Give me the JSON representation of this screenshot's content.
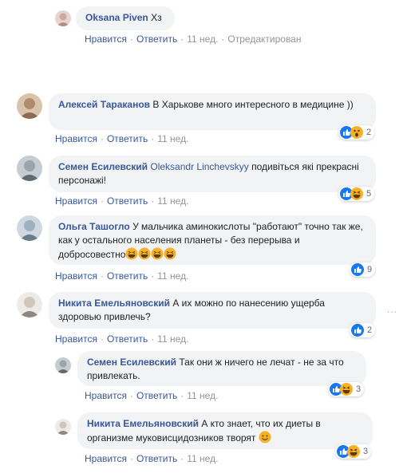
{
  "actions": {
    "like": "Нравится",
    "reply": "Ответить",
    "sep": "·"
  },
  "comments": [
    {
      "author": "Oksana Piven",
      "text": "Хз",
      "time": "11 нед.",
      "edited": "Отредактирован",
      "avatar_color": "#c9a8a0"
    },
    {
      "author": "Алексей Тараканов",
      "text": "В Харькове много интересного в медицине ))",
      "time": "11 нед.",
      "reactions": [
        "like",
        "wow"
      ],
      "reaction_count": "2",
      "avatar_color": "#b08b6e"
    },
    {
      "author": "Семен Есилевский",
      "mention": "Oleksandr Linchevskyy",
      "text": "подивіться які прекрасні персонажі!",
      "time": "11 нед.",
      "reactions": [
        "like",
        "haha"
      ],
      "reaction_count": "5",
      "avatar_color": "#7f8a93"
    },
    {
      "author": "Ольга Ташогло",
      "text": "У мальчика аминокислоты \"работают\" точно так же, как у остального населения планеты - без перерыва и добросовестно",
      "time": "11 нед.",
      "reactions": [
        "like"
      ],
      "reaction_count": "9",
      "avatar_color": "#8a9aa8"
    },
    {
      "author": "Никита Емельяновский",
      "text": "А их можно по нанесению ущерба здоровью привлечь?",
      "time": "11 нед.",
      "reactions": [
        "like"
      ],
      "reaction_count": "2",
      "avatar_color": "#d8d4cf"
    },
    {
      "author": "Семен Есилевский",
      "text": "Так они ж ничего не лечат - не за что привлекать.",
      "time": "11 нед.",
      "reactions": [
        "like",
        "haha"
      ],
      "reaction_count": "3",
      "avatar_color": "#7f8a93"
    },
    {
      "author": "Никита Емельяновский",
      "text": "А кто знает, что их диеты в организме муковисцидозников творят",
      "time": "11 нед.",
      "reactions": [
        "like",
        "haha"
      ],
      "reaction_count": "3",
      "avatar_color": "#d8d4cf"
    }
  ],
  "more_icon": "…",
  "colors": {
    "link": "#385898",
    "bubble": "#f2f3f5",
    "meta": "#90949c",
    "like": "#1877f2",
    "emoji": "#f7b125"
  }
}
